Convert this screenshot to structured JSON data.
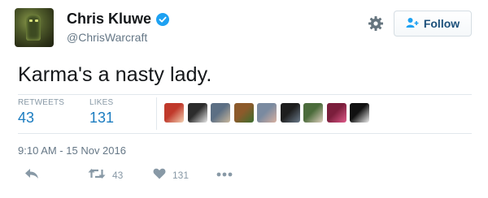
{
  "user": {
    "name": "Chris Kluwe",
    "handle": "@ChrisWarcraft",
    "verified": true
  },
  "follow_button": {
    "label": "Follow",
    "icon": "add-user-icon"
  },
  "settings_icon": "gear-icon",
  "tweet": {
    "text": "Karma's a nasty lady.",
    "timestamp": "9:10 AM - 15 Nov 2016"
  },
  "stats": {
    "retweets_label": "RETWEETS",
    "retweets_count": "43",
    "likes_label": "LIKES",
    "likes_count": "131"
  },
  "likers": [
    {
      "name": "liker-avatar-1",
      "colors": [
        "#c0392b",
        "#f3d2b3"
      ]
    },
    {
      "name": "liker-avatar-2",
      "colors": [
        "#2c2c2c",
        "#e8e8e8"
      ]
    },
    {
      "name": "liker-avatar-3",
      "colors": [
        "#5c6f84",
        "#c9b79c"
      ]
    },
    {
      "name": "liker-avatar-4",
      "colors": [
        "#8c5a2b",
        "#3b6e2e"
      ]
    },
    {
      "name": "liker-avatar-5",
      "colors": [
        "#7a8aa0",
        "#d8b0a0"
      ]
    },
    {
      "name": "liker-avatar-6",
      "colors": [
        "#1e1e1e",
        "#6b7b8b"
      ]
    },
    {
      "name": "liker-avatar-7",
      "colors": [
        "#4b6b3b",
        "#e0d0c0"
      ]
    },
    {
      "name": "liker-avatar-8",
      "colors": [
        "#7b1e3c",
        "#e05a8a"
      ]
    },
    {
      "name": "liker-avatar-9",
      "colors": [
        "#111111",
        "#f0f0f0"
      ]
    }
  ],
  "actions": {
    "reply_icon": "reply-icon",
    "retweet_icon": "retweet-icon",
    "retweet_count": "43",
    "like_icon": "heart-icon",
    "like_count": "131",
    "more_icon": "more-dots-icon"
  },
  "colors": {
    "accent": "#1da1f2",
    "count_blue": "#1b7cc0",
    "muted": "#657786"
  }
}
